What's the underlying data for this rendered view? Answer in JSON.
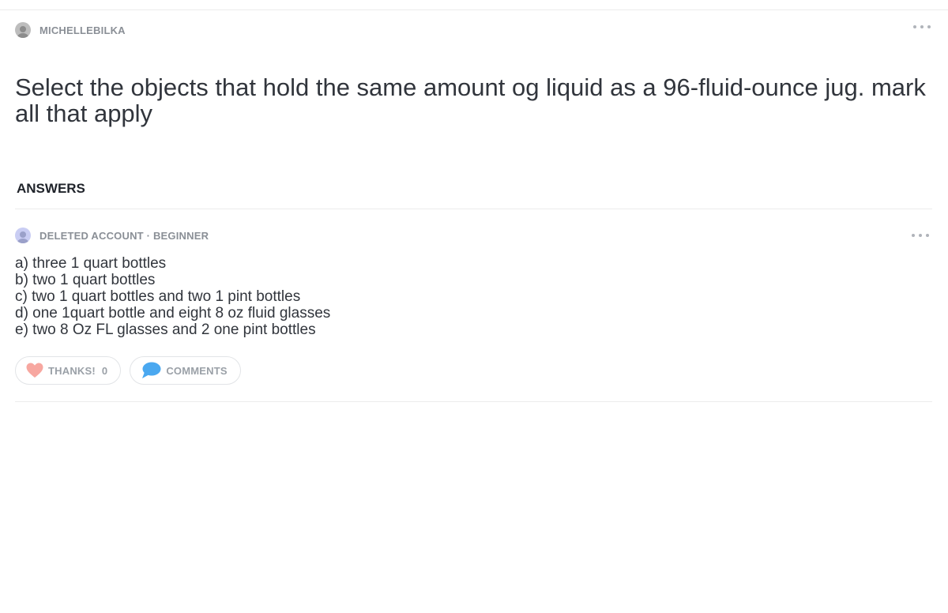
{
  "question": {
    "author": "MICHELLEBILKA",
    "text": "Select the objects that hold the same amount og liquid as a 96-fluid-ounce jug. mark all that apply"
  },
  "answers_section": {
    "heading": "ANSWERS"
  },
  "answer": {
    "author_line": "DELETED ACCOUNT · BEGINNER",
    "lines": [
      "a) three 1 quart bottles",
      "b) two 1 quart bottles",
      "c) two 1 quart bottles and two 1 pint bottles",
      "d) one 1quart bottle and eight 8 oz fluid glasses",
      "e) two 8 Oz FL glasses and 2 one pint bottles"
    ],
    "thanks_label": "THANKS!",
    "thanks_count": "0",
    "comments_label": "COMMENTS"
  },
  "icons": {
    "heart": "heart-icon",
    "comment": "speech-bubble-icon",
    "more": "more-options-icon"
  },
  "colors": {
    "heart": "#f7a7a0",
    "comment_bubble": "#4aa8f0",
    "muted_text": "#8a8f96"
  }
}
